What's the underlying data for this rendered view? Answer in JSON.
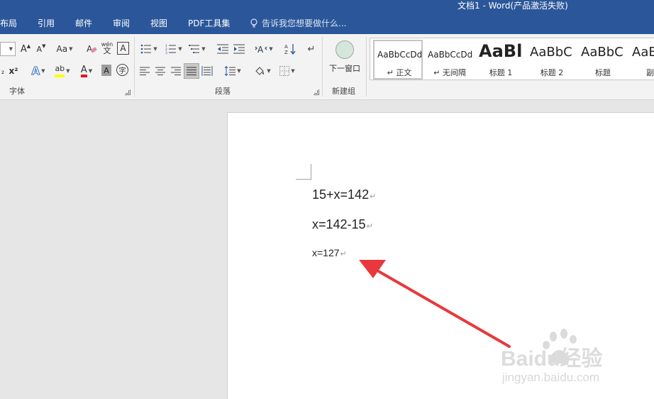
{
  "window": {
    "title": "文档1 - Word(产品激活失败)"
  },
  "tabs": [
    "布局",
    "引用",
    "邮件",
    "审阅",
    "视图",
    "PDF工具集"
  ],
  "tell_me": "告诉我您想要做什么...",
  "font_group": {
    "label": "字体",
    "grow_font": "A",
    "shrink_font": "A",
    "change_case": "Aa",
    "phonetic_top": "wén",
    "phonetic_bottom": "文",
    "char_border": "A",
    "superscript": "x²",
    "text_effects": "A",
    "highlight": "ab",
    "font_color": "A",
    "char_shading": "A",
    "enclose": "字",
    "highlight_color": "#ffff00",
    "font_color_value": "#e81123"
  },
  "paragraph_group": {
    "label": "段落"
  },
  "new_group": {
    "label": "新建组",
    "button": "下一窗口"
  },
  "styles": [
    {
      "sample": "AaBbCcDd",
      "name": "↵ 正文"
    },
    {
      "sample": "AaBbCcDd",
      "name": "↵ 无间隔"
    },
    {
      "sample": "AaBl",
      "name": "标题 1"
    },
    {
      "sample": "AaBbC",
      "name": "标题 2"
    },
    {
      "sample": "AaBbC",
      "name": "标题"
    },
    {
      "sample": "AaBl",
      "name": "副标"
    }
  ],
  "document": {
    "lines": [
      "15+x=142",
      "x=142-15",
      "x=127"
    ],
    "paragraph_mark": "↵"
  },
  "watermark": {
    "brand": "Baidu经验",
    "url": "jingyan.baidu.com"
  },
  "colors": {
    "title_bar": "#2b579a",
    "arrow": "#e8383d"
  }
}
